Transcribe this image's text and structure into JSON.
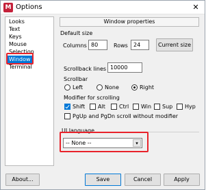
{
  "window": {
    "title": "Options",
    "app_icon": "putty-icon"
  },
  "sidebar": {
    "items": [
      {
        "label": "Looks"
      },
      {
        "label": "Text"
      },
      {
        "label": "Keys"
      },
      {
        "label": "Mouse"
      },
      {
        "label": "Selection"
      },
      {
        "label": "Window",
        "selected": true
      },
      {
        "label": "Terminal"
      }
    ]
  },
  "panel": {
    "header": "Window properties",
    "default_size": {
      "heading": "Default size",
      "columns_label": "Columns",
      "columns_value": "80",
      "rows_label": "Rows",
      "rows_value": "24",
      "current_size_button": "Current size"
    },
    "scrollback": {
      "label": "Scrollback lines",
      "value": "10000"
    },
    "scrollbar": {
      "heading": "Scrollbar",
      "options": [
        {
          "label": "Left",
          "selected": false
        },
        {
          "label": "None",
          "selected": false
        },
        {
          "label": "Right",
          "selected": true
        }
      ]
    },
    "modifier": {
      "heading": "Modifier for scrolling",
      "options": [
        {
          "label": "Shift",
          "checked": true
        },
        {
          "label": "Alt",
          "checked": false
        },
        {
          "label": "Ctrl",
          "checked": false
        },
        {
          "label": "Win",
          "checked": false
        },
        {
          "label": "Sup",
          "checked": false
        },
        {
          "label": "Hyp",
          "checked": false
        }
      ],
      "pgup_label": "PgUp and PgDn scroll without modifier",
      "pgup_checked": false
    },
    "ui_language": {
      "heading": "UI language",
      "value": "-- None --"
    }
  },
  "footer": {
    "about_button": "About...",
    "save_button": "Save",
    "cancel_button": "Cancel",
    "apply_button": "Apply"
  },
  "colors": {
    "annotation": "#e8222a",
    "selection": "#0078d7"
  }
}
